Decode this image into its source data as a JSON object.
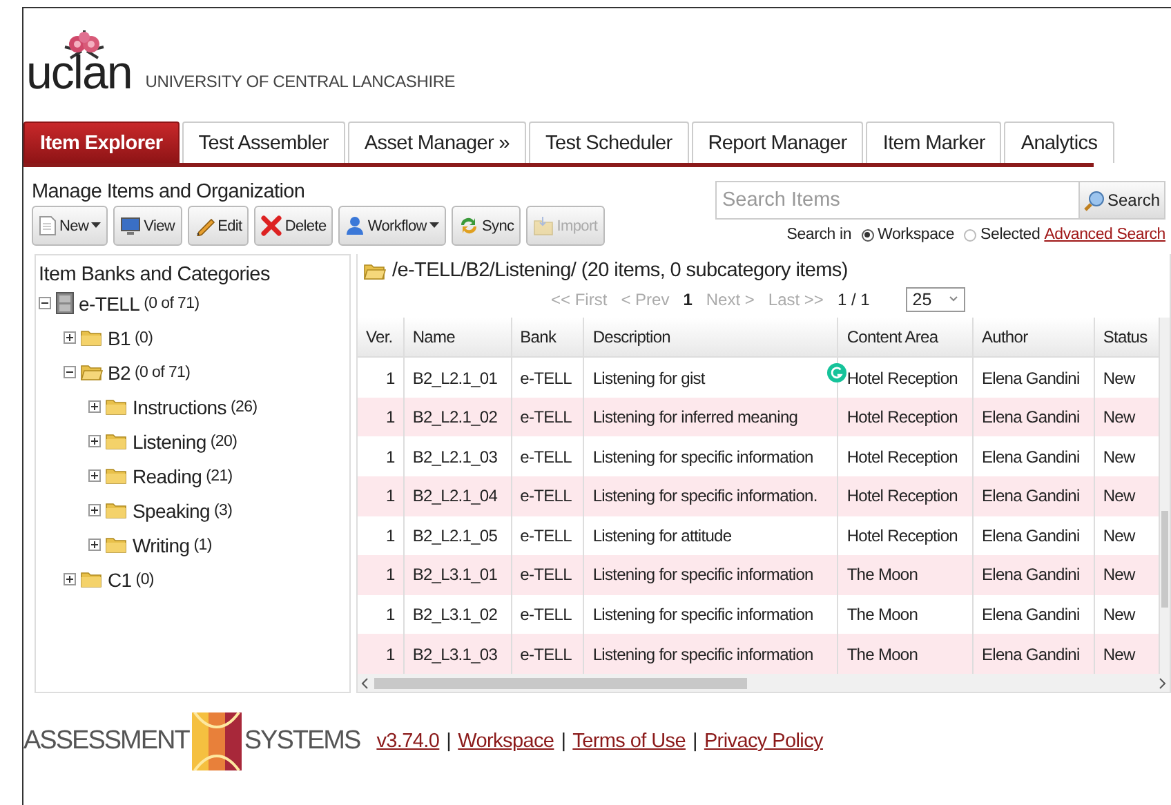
{
  "header": {
    "logo": "uclan",
    "university": "UNIVERSITY OF CENTRAL LANCASHIRE"
  },
  "tabs": [
    {
      "label": "Item Explorer",
      "selected": true
    },
    {
      "label": "Test Assembler",
      "selected": false
    },
    {
      "label": "Asset Manager »",
      "selected": false
    },
    {
      "label": "Test Scheduler",
      "selected": false
    },
    {
      "label": "Report Manager",
      "selected": false
    },
    {
      "label": "Item Marker",
      "selected": false
    },
    {
      "label": "Analytics",
      "selected": false
    }
  ],
  "section_title": "Manage Items and Organization",
  "toolbar": [
    {
      "label": "New",
      "kind": "new",
      "dropdown": true,
      "disabled": false
    },
    {
      "label": "View",
      "kind": "view",
      "dropdown": false,
      "disabled": false
    },
    {
      "label": "Edit",
      "kind": "edit",
      "dropdown": false,
      "disabled": false
    },
    {
      "label": "Delete",
      "kind": "delete",
      "dropdown": false,
      "disabled": false
    },
    {
      "label": "Workflow",
      "kind": "workflow",
      "dropdown": true,
      "disabled": false
    },
    {
      "label": "Sync",
      "kind": "sync",
      "dropdown": false,
      "disabled": false
    },
    {
      "label": "Import",
      "kind": "import",
      "dropdown": false,
      "disabled": true
    }
  ],
  "search": {
    "placeholder": "Search Items",
    "button": "Search",
    "scope_label": "Search in",
    "scopes": [
      {
        "label": "Workspace",
        "selected": true
      },
      {
        "label": "Selected",
        "selected": false
      }
    ],
    "advanced_link": "Advanced Search"
  },
  "tree": {
    "title": "Item Banks and Categories",
    "nodes": [
      {
        "label": "e-TELL",
        "count": "(0 of 71)",
        "kind": "bank",
        "expanded": true,
        "children": [
          {
            "label": "B1",
            "count": "(0)",
            "kind": "folder",
            "expanded": false
          },
          {
            "label": "B2",
            "count": "(0 of 71)",
            "kind": "folder",
            "expanded": true,
            "children": [
              {
                "label": "Instructions",
                "count": "(26)",
                "kind": "folder",
                "expanded": false
              },
              {
                "label": "Listening",
                "count": "(20)",
                "kind": "folder",
                "expanded": false
              },
              {
                "label": "Reading",
                "count": "(21)",
                "kind": "folder",
                "expanded": false
              },
              {
                "label": "Speaking",
                "count": "(3)",
                "kind": "folder",
                "expanded": false
              },
              {
                "label": "Writing",
                "count": "(1)",
                "kind": "folder",
                "expanded": false
              }
            ]
          },
          {
            "label": "C1",
            "count": "(0)",
            "kind": "folder",
            "expanded": false
          }
        ]
      }
    ]
  },
  "listing": {
    "path": "/e-TELL/B2/Listening/",
    "summary": "(20 items, 0 subcategory items)",
    "pager": [
      {
        "label": "<< First",
        "kind": "link",
        "disabled": true
      },
      {
        "label": "< Prev",
        "kind": "link",
        "disabled": true
      },
      {
        "label": "1",
        "kind": "current",
        "disabled": false
      },
      {
        "label": "Next >",
        "kind": "link",
        "disabled": true
      },
      {
        "label": "Last >>",
        "kind": "link",
        "disabled": true
      },
      {
        "label": "1 / 1",
        "kind": "count",
        "disabled": false
      }
    ],
    "page_size": "25",
    "columns": [
      "Ver.",
      "Name",
      "Bank",
      "Description",
      "Content Area",
      "Author",
      "Status"
    ],
    "rows": [
      [
        "1",
        "B2_L2.1_01",
        "e-TELL",
        "Listening for gist",
        "Hotel Reception",
        "Elena Gandini",
        "New"
      ],
      [
        "1",
        "B2_L2.1_02",
        "e-TELL",
        "Listening for inferred meaning",
        "Hotel Reception",
        "Elena Gandini",
        "New"
      ],
      [
        "1",
        "B2_L2.1_03",
        "e-TELL",
        "Listening for specific information",
        "Hotel Reception",
        "Elena Gandini",
        "New"
      ],
      [
        "1",
        "B2_L2.1_04",
        "e-TELL",
        "Listening for specific information.",
        "Hotel Reception",
        "Elena Gandini",
        "New"
      ],
      [
        "1",
        "B2_L2.1_05",
        "e-TELL",
        "Listening for attitude",
        "Hotel Reception",
        "Elena Gandini",
        "New"
      ],
      [
        "1",
        "B2_L3.1_01",
        "e-TELL",
        "Listening for specific information",
        "The Moon",
        "Elena Gandini",
        "New"
      ],
      [
        "1",
        "B2_L3.1_02",
        "e-TELL",
        "Listening for specific information",
        "The Moon",
        "Elena Gandini",
        "New"
      ],
      [
        "1",
        "B2_L3.1_03",
        "e-TELL",
        "Listening for specific information",
        "The Moon",
        "Elena Gandini",
        "New"
      ]
    ]
  },
  "footer": {
    "logo_left": "ASSESSMENT",
    "logo_right": "SYSTEMS",
    "separator": "|",
    "links": [
      "v3.74.0",
      "Workspace",
      "Terms of Use",
      "Privacy Policy"
    ]
  }
}
